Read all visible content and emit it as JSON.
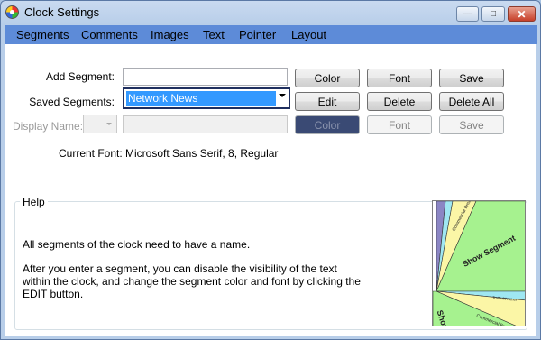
{
  "window": {
    "title": "Clock Settings",
    "icon": "clock-color-wheel-icon",
    "controls": {
      "minimize": "—",
      "maximize": "□",
      "close": "✕"
    }
  },
  "menu": [
    "Segments",
    "Comments",
    "Images",
    "Text",
    "Pointer",
    "Layout"
  ],
  "form": {
    "add_segment_label": "Add Segment:",
    "add_segment_value": "",
    "saved_segments_label": "Saved Segments:",
    "saved_segments_value": "Network News",
    "display_name_label": "Display Name:",
    "current_font_label": "Current Font:",
    "current_font_value": "Microsoft Sans Serif, 8, Regular"
  },
  "buttons": {
    "row1": [
      "Color",
      "Font",
      "Save"
    ],
    "row2": [
      "Edit",
      "Delete",
      "Delete All"
    ],
    "row3": [
      "Color",
      "Font",
      "Save"
    ]
  },
  "help": {
    "title": "Help",
    "paragraph1": "All segments of the clock need to have a name.",
    "paragraph2": "After you enter a segment, you can disable the visibility of the text within the clock, and change the segment color and font by clicking the EDIT button."
  },
  "preview": {
    "segments": [
      "Show Segment",
      "Commercial Break",
      "Commercial Break",
      "Traffic/Weather",
      "Show"
    ],
    "colors": {
      "main": "#a6f28f",
      "yellow": "#fbf6a6",
      "cyan": "#9fe7f2",
      "purple": "#8b86c4"
    }
  },
  "accent": {
    "menubar": "#5d8bd8",
    "selection": "#3399ff",
    "display_color": "#3a4a74"
  }
}
